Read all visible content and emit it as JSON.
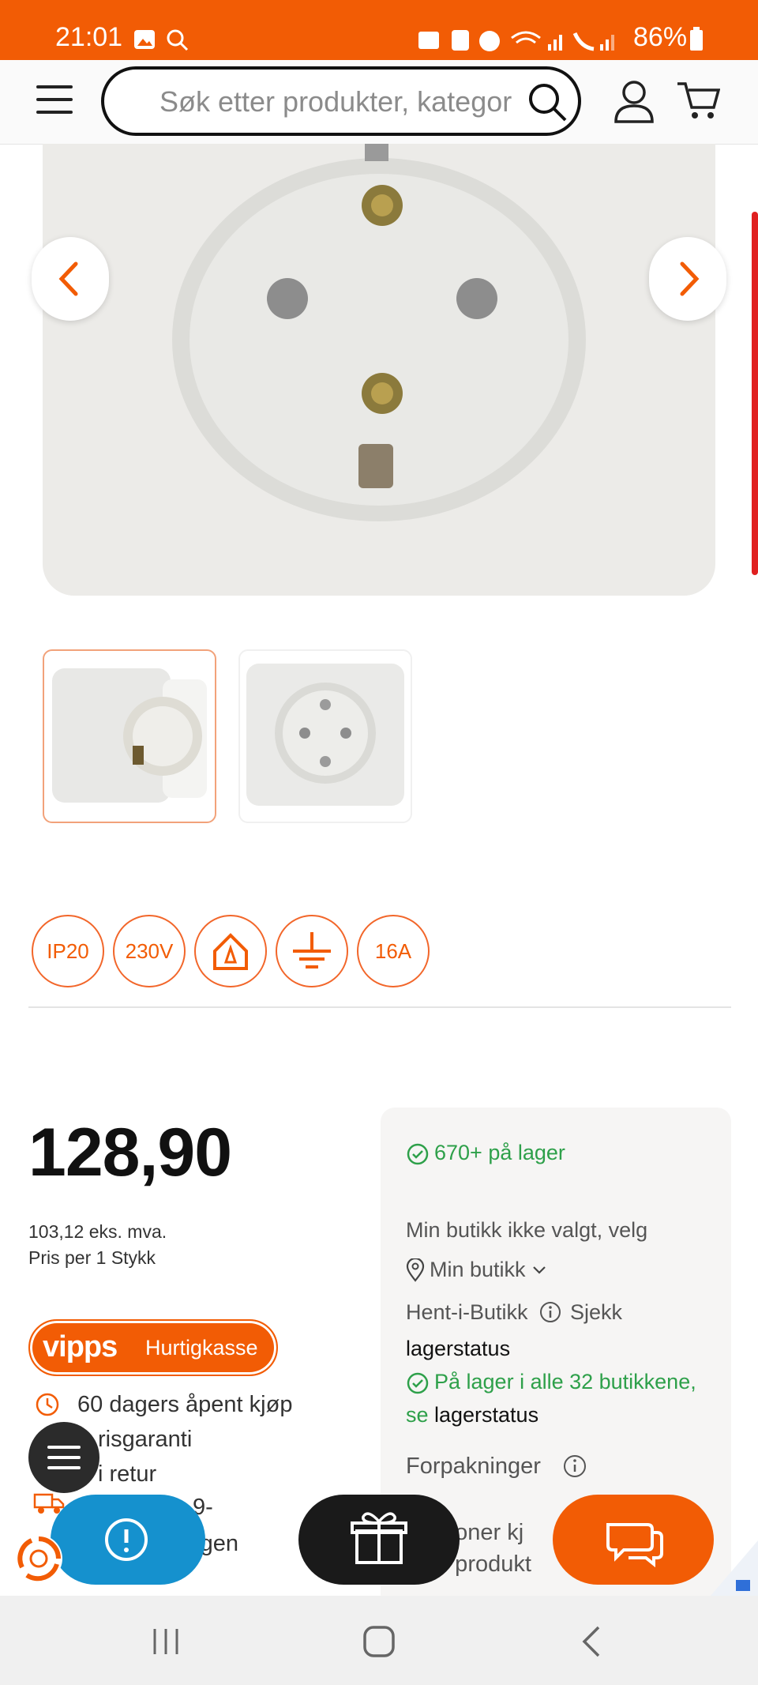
{
  "status_bar": {
    "time": "21:01",
    "battery": "86%"
  },
  "header": {
    "search_placeholder": "Søk etter produkter, kategor"
  },
  "badges": [
    "IP20",
    "230V",
    "",
    "",
    "16A"
  ],
  "price": {
    "amount": "128,90",
    "ex_vat": "103,12 eks. mva.",
    "unit": "Pris per 1 Stykk"
  },
  "stock": {
    "in_stock": "670+ på lager",
    "store_not_selected": "Min butikk ikke valgt, velg",
    "my_store": "Min butikk",
    "pickup": "Hent-i-Butikk",
    "check": "Sjekk",
    "lagerstatus": "lagerstatus",
    "all_stores": "På lager i alle 32 butikkene,",
    "se": "se",
    "lagerstatus2": "lagerstatus",
    "packaging": "Forpakninger",
    "others_line1": "rsoner kj",
    "others_line2": "e produkt"
  },
  "vipps": {
    "logo": "vipps",
    "label": "Hurtigkasse"
  },
  "benefits": [
    "60 dagers åpent kjøp",
    "risgaranti",
    "i retur",
    "9-",
    "rgen"
  ],
  "colors": {
    "brand": "#f25c05",
    "green": "#2ea04a",
    "blue": "#1591ce"
  }
}
